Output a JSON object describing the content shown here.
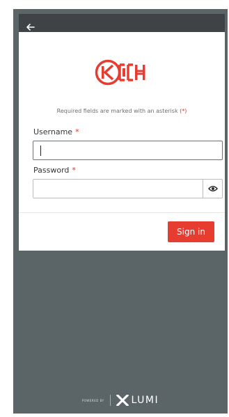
{
  "header": {
    "back_icon": "arrow-left-icon"
  },
  "logo": {
    "name": "CKH-logo",
    "color": "#e73c30"
  },
  "form": {
    "required_note_text": "Required fields are marked with an asterisk",
    "required_note_marker": "(*)",
    "username": {
      "label": "Username",
      "asterisk": "*",
      "value": ""
    },
    "password": {
      "label": "Password",
      "asterisk": "*",
      "value": "",
      "toggle_icon": "eye-icon"
    },
    "signin_label": "Sign in"
  },
  "footer": {
    "powered_by": "POWERED BY",
    "brand": "LUMI",
    "brand_icon": "x-logo-icon"
  },
  "colors": {
    "accent": "#e73c30",
    "background": "#5b6567",
    "topbar": "#3f4345"
  }
}
